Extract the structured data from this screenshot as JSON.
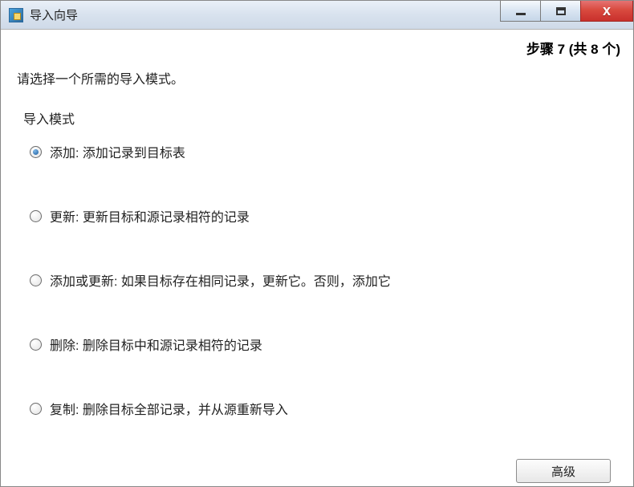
{
  "window": {
    "title": "导入向导"
  },
  "step": {
    "text": "步骤 7 (共 8 个)"
  },
  "prompt": "请选择一个所需的导入模式。",
  "group_label": "导入模式",
  "options": [
    {
      "label": "添加: 添加记录到目标表",
      "selected": true
    },
    {
      "label": "更新: 更新目标和源记录相符的记录",
      "selected": false
    },
    {
      "label": "添加或更新: 如果目标存在相同记录，更新它。否则，添加它",
      "selected": false
    },
    {
      "label": "删除: 删除目标中和源记录相符的记录",
      "selected": false
    },
    {
      "label": "复制: 删除目标全部记录，并从源重新导入",
      "selected": false
    }
  ],
  "buttons": {
    "advanced": "高级"
  }
}
